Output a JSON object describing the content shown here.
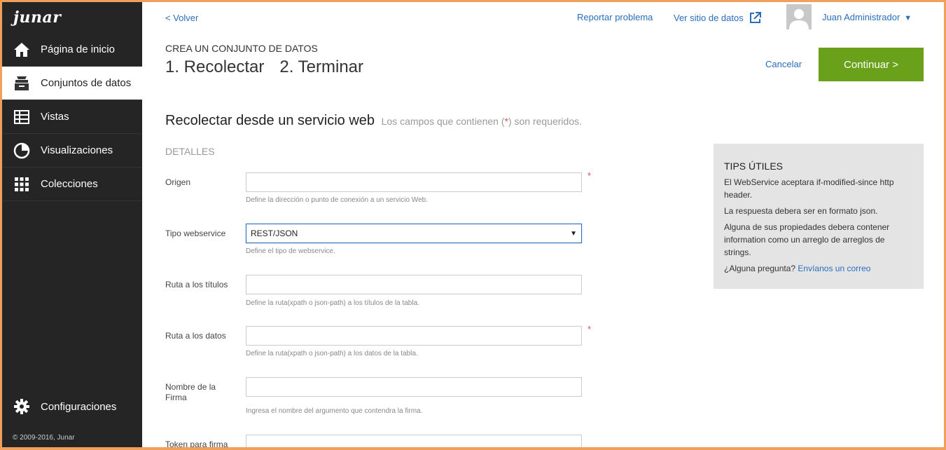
{
  "brand": {
    "logo_text": "junar"
  },
  "sidebar": {
    "items": [
      {
        "label": "Página de inicio",
        "icon": "home-icon"
      },
      {
        "label": "Conjuntos de datos",
        "icon": "datasets-icon"
      },
      {
        "label": "Vistas",
        "icon": "table-icon"
      },
      {
        "label": "Visualizaciones",
        "icon": "pie-chart-icon"
      },
      {
        "label": "Colecciones",
        "icon": "grid-icon"
      }
    ],
    "settings_label": "Configuraciones",
    "copyright": "© 2009-2016, Junar"
  },
  "topbar": {
    "back": "< Volver",
    "report": "Reportar problema",
    "view_site": "Ver sitio de datos",
    "user_name": "Juan Administrador",
    "user_caret": "▼"
  },
  "header": {
    "kicker": "CREA UN CONJUNTO DE DATOS",
    "step1": "1. Recolectar",
    "step2": "2. Terminar",
    "cancel": "Cancelar",
    "continue": "Continuar >"
  },
  "form": {
    "title": "Recolectar desde un servicio web",
    "subtitle_pre": "Los campos que contienen (",
    "subtitle_star": "*",
    "subtitle_post": ") son requeridos.",
    "section": "DETALLES",
    "required_mark": "*",
    "fields": {
      "origen": {
        "label": "Origen",
        "value": "",
        "help": "Define la dirección o punto de conexión a un servicio Web."
      },
      "tipo": {
        "label": "Tipo webservice",
        "value": "REST/JSON",
        "help": "Define el tipo de webservice."
      },
      "titulos": {
        "label": "Ruta a los títulos",
        "value": "",
        "help": "Define la ruta(xpath o json-path) a los títulos de la tabla."
      },
      "datos": {
        "label": "Ruta a los datos",
        "value": "",
        "help": "Define la ruta(xpath o json-path) a los datos de la tabla."
      },
      "firma": {
        "label": "Nombre de la Firma",
        "value": "",
        "help": "Ingresa el nombre del argumento que contendra la firma."
      },
      "token": {
        "label": "Token para firma",
        "value": ""
      }
    }
  },
  "tips": {
    "title": "TIPS ÚTILES",
    "t1": "El WebService aceptara if-modified-since http header.",
    "t2": "La respuesta debera ser en formato json.",
    "t3": "Alguna de sus propiedades debera contener information como un arreglo de arreglos de strings.",
    "t4_pre": "¿Alguna pregunta?",
    "t4_link": "Envíanos un correo"
  },
  "colors": {
    "accent": "#2a6ebb",
    "primary_button": "#6aa11b",
    "sidebar_bg": "#252525",
    "required": "#d9534f",
    "frame": "#f0a05a"
  }
}
